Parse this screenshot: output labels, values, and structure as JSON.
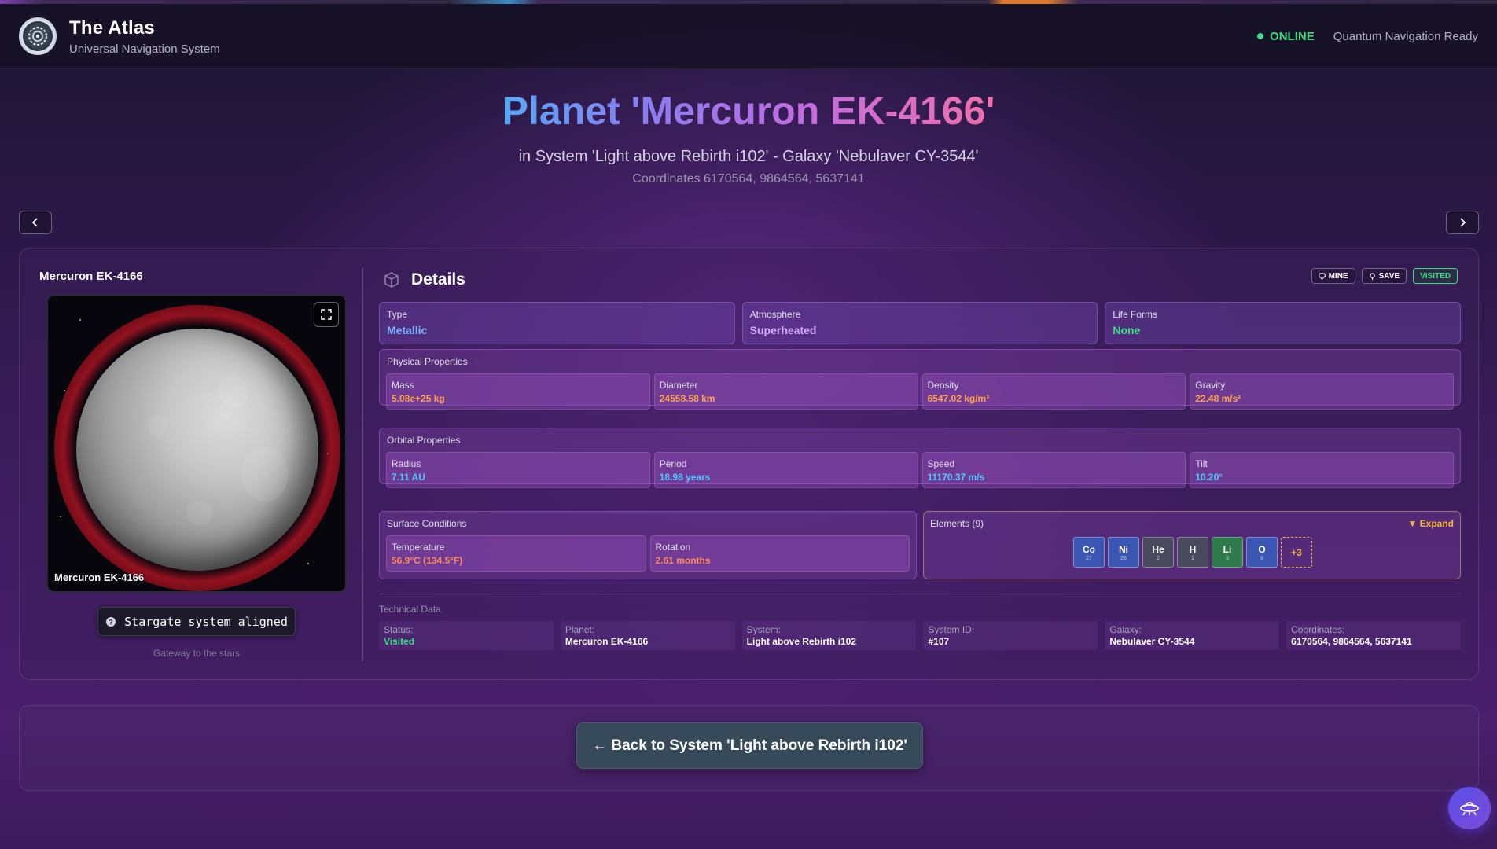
{
  "header": {
    "title": "The Atlas",
    "subtitle": "Universal Navigation System",
    "status": "ONLINE",
    "status_text": "Quantum Navigation Ready"
  },
  "hero": {
    "title": "Planet 'Mercuron EK-4166'",
    "subtitle": "in System 'Light above Rebirth i102' - Galaxy 'Nebulaver CY-3544'",
    "coordinates": "Coordinates 6170564, 9864564, 5637141"
  },
  "nav": {
    "prev_icon": "chevron-left-icon",
    "next_icon": "chevron-right-icon"
  },
  "planet_panel": {
    "name": "Mercuron EK-4166",
    "image_label": "Mercuron EK-4166",
    "stargate_label": "Stargate system aligned",
    "gateway_text": "Gateway to the stars"
  },
  "details": {
    "title": "Details",
    "pills": {
      "mine": "MINE",
      "save": "SAVE",
      "visited": "VISITED"
    },
    "type": {
      "label": "Type",
      "value": "Metallic",
      "color": "#7fb0ff"
    },
    "atmosphere": {
      "label": "Atmosphere",
      "value": "Superheated",
      "color": "#d9a8ff"
    },
    "life_forms": {
      "label": "Life Forms",
      "value": "None",
      "color": "#3ddc84"
    },
    "physical": {
      "title": "Physical Properties",
      "color": "#ffa24a",
      "items": [
        {
          "label": "Mass",
          "value": "5.08e+25 kg"
        },
        {
          "label": "Diameter",
          "value": "24558.58 km"
        },
        {
          "label": "Density",
          "value": "6547.02 kg/m³"
        },
        {
          "label": "Gravity",
          "value": "22.48 m/s²"
        }
      ]
    },
    "orbital": {
      "title": "Orbital Properties",
      "color": "#4fc8ff",
      "items": [
        {
          "label": "Radius",
          "value": "7.11 AU"
        },
        {
          "label": "Period",
          "value": "18.98 years"
        },
        {
          "label": "Speed",
          "value": "11170.37 m/s"
        },
        {
          "label": "Tilt",
          "value": "10.20°"
        }
      ]
    },
    "surface": {
      "title": "Surface Conditions",
      "color": "#ff8a5c",
      "items": [
        {
          "label": "Temperature",
          "value": "56.9°C (134.5°F)"
        },
        {
          "label": "Rotation",
          "value": "2.61 months"
        }
      ]
    },
    "elements": {
      "title": "Elements (9)",
      "expand": "▼ Expand",
      "more": "+3",
      "items": [
        {
          "symbol": "Co",
          "number": "27",
          "color": "#3b56b3"
        },
        {
          "symbol": "Ni",
          "number": "28",
          "color": "#3b56b3"
        },
        {
          "symbol": "He",
          "number": "2",
          "color": "#4a4a5e"
        },
        {
          "symbol": "H",
          "number": "1",
          "color": "#4a4a5e"
        },
        {
          "symbol": "Li",
          "number": "3",
          "color": "#2f7a4a"
        },
        {
          "symbol": "O",
          "number": "8",
          "color": "#3b56b3"
        }
      ]
    },
    "technical": {
      "title": "Technical Data",
      "items": [
        {
          "label": "Status:",
          "value": "Visited",
          "color": "#3ddc84"
        },
        {
          "label": "Planet:",
          "value": "Mercuron EK-4166",
          "color": "#ffffff"
        },
        {
          "label": "System:",
          "value": "Light above Rebirth i102",
          "color": "#ffffff"
        },
        {
          "label": "System ID:",
          "value": "#107",
          "color": "#ffffff"
        },
        {
          "label": "Galaxy:",
          "value": "Nebulaver CY-3544",
          "color": "#ffffff"
        },
        {
          "label": "Coordinates:",
          "value": "6170564, 9864564, 5637141",
          "color": "#ffffff"
        }
      ]
    }
  },
  "back_button": "← Back to System 'Light above Rebirth i102'"
}
